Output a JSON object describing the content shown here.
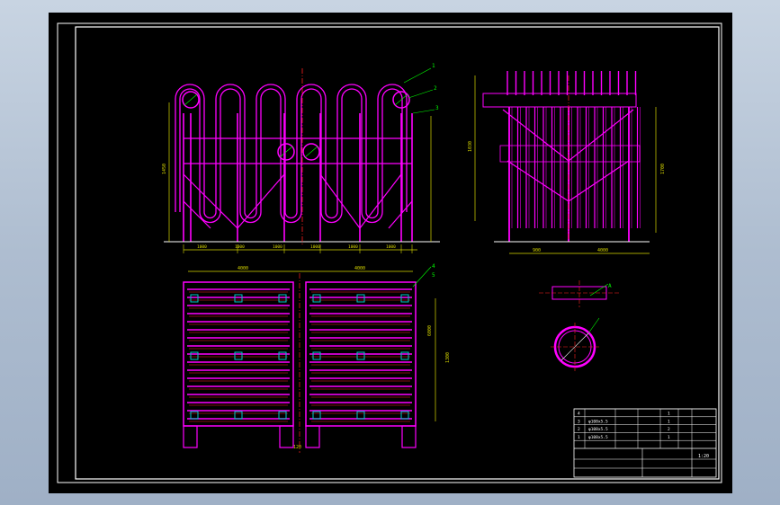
{
  "colors": {
    "background": "#000000",
    "frame": "#ffffff",
    "coil": "#ff00ff",
    "centerline": "#ff2020",
    "dimension": "#d8d800",
    "header": "#00c8c8",
    "annotation": "#00ff00",
    "title_block": "#ffffff"
  },
  "leaders": {
    "front_1": "1",
    "front_2": "2",
    "front_3": "3",
    "plan_4": "4",
    "plan_5": "5",
    "detail_a": "A"
  },
  "dims": {
    "front_left_height": "1450",
    "front_span": "1000",
    "front_bottom": [
      "1000",
      "1000",
      "1000",
      "1000",
      "1000",
      "1000"
    ],
    "side_height": "1030",
    "side_right_height": "1700",
    "side_bottom": [
      "900",
      "4000"
    ],
    "plan_top": [
      "4000",
      "4000"
    ],
    "plan_right": [
      "6000",
      "1300"
    ],
    "plan_bottom": "120"
  },
  "title_block": {
    "rows": [
      {
        "no": "4",
        "name": "",
        "qty": "",
        "mat": "",
        "note": "1"
      },
      {
        "no": "3",
        "name": "φ108x5.5",
        "qty": "",
        "mat": "",
        "note": "1"
      },
      {
        "no": "2",
        "name": "φ108x5.5",
        "qty": "",
        "mat": "",
        "note": "2"
      },
      {
        "no": "1",
        "name": "φ108x5.5",
        "qty": "",
        "mat": "",
        "note": "1"
      },
      {
        "no": "",
        "name": "",
        "qty": "",
        "mat": "",
        "note": ""
      }
    ],
    "drawing_title": "",
    "company": "",
    "scale": "1:20",
    "drawing_no": ""
  }
}
